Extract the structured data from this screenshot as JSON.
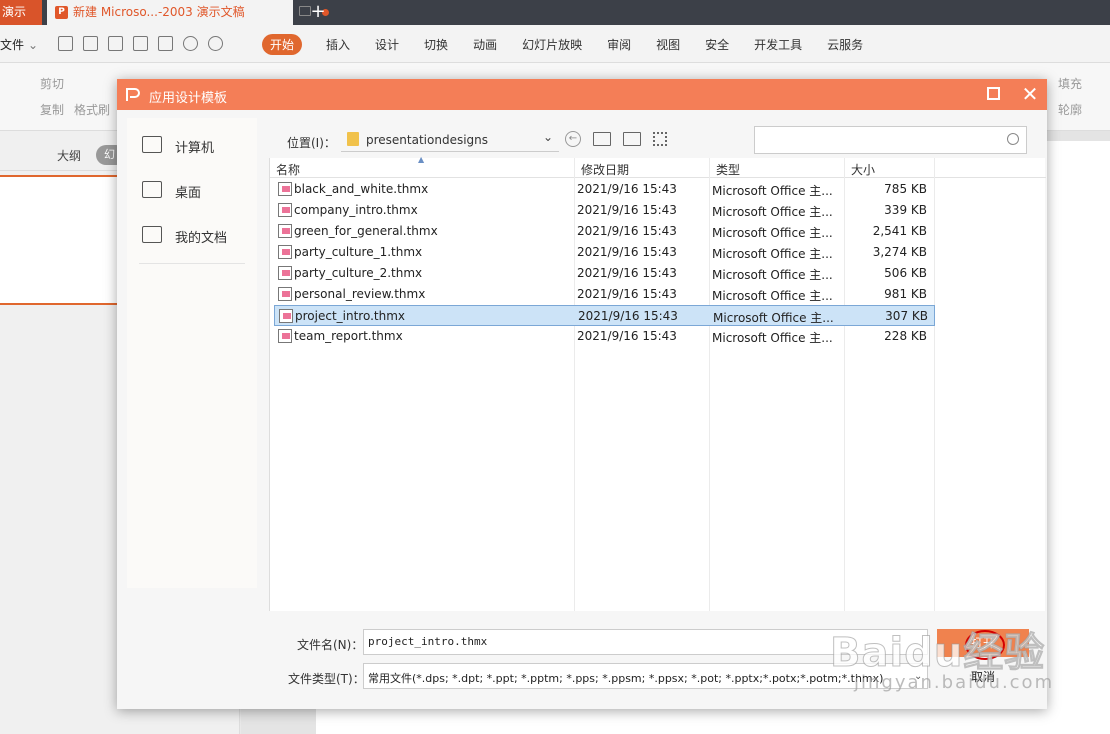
{
  "app": {
    "prev_tab": "演示",
    "doc_tab": "新建 Microso...-2003 演示文稿",
    "ppt_badge": "P",
    "new_tab": "+"
  },
  "menubar": {
    "file": "文件",
    "items": [
      "开始",
      "插入",
      "设计",
      "切换",
      "动画",
      "幻灯片放映",
      "审阅",
      "视图",
      "安全",
      "开发工具",
      "云服务"
    ],
    "active": "开始"
  },
  "ribbon": {
    "cut": "剪切",
    "copy": "复制",
    "format_painter": "格式刷",
    "fill": "填充",
    "outline": "轮廓"
  },
  "left_panel": {
    "outline_tab": "大纲",
    "slides_tab": "幻"
  },
  "dialog": {
    "title": "应用设计模板",
    "places": [
      {
        "label": "计算机",
        "icon": "computer-icon"
      },
      {
        "label": "桌面",
        "icon": "desktop-icon"
      },
      {
        "label": "我的文档",
        "icon": "documents-icon"
      }
    ],
    "location_label": "位置(I)：",
    "location_value": "presentationdesigns",
    "search_placeholder": "",
    "columns": [
      "名称",
      "修改日期",
      "类型",
      "大小"
    ],
    "files": [
      {
        "name": "black_and_white.thmx",
        "date": "2021/9/16 15:43",
        "type": "Microsoft Office 主...",
        "size": "785 KB"
      },
      {
        "name": "company_intro.thmx",
        "date": "2021/9/16 15:43",
        "type": "Microsoft Office 主...",
        "size": "339 KB"
      },
      {
        "name": "green_for_general.thmx",
        "date": "2021/9/16 15:43",
        "type": "Microsoft Office 主...",
        "size": "2,541 KB"
      },
      {
        "name": "party_culture_1.thmx",
        "date": "2021/9/16 15:43",
        "type": "Microsoft Office 主...",
        "size": "3,274 KB"
      },
      {
        "name": "party_culture_2.thmx",
        "date": "2021/9/16 15:43",
        "type": "Microsoft Office 主...",
        "size": "506 KB"
      },
      {
        "name": "personal_review.thmx",
        "date": "2021/9/16 15:43",
        "type": "Microsoft Office 主...",
        "size": "981 KB"
      },
      {
        "name": "project_intro.thmx",
        "date": "2021/9/16 15:43",
        "type": "Microsoft Office 主...",
        "size": "307 KB"
      },
      {
        "name": "team_report.thmx",
        "date": "2021/9/16 15:43",
        "type": "Microsoft Office 主...",
        "size": "228 KB"
      }
    ],
    "selected_index": 6,
    "filename_label": "文件名(N)：",
    "filename_value": "project_intro.thmx",
    "filetype_label": "文件类型(T)：",
    "filetype_value": "常用文件(*.dps; *.dpt; *.ppt; *.pptm; *.pps; *.ppsm; *.ppsx; *.pot; *.pptx;*.potx;*.potm;*.thmx)",
    "open_button": "打开",
    "cancel_button": "取消"
  },
  "watermark": {
    "main": "Baidu经验",
    "sub": "jingyan.baidu.com"
  },
  "colors": {
    "accent": "#e0672e",
    "dialog_title": "#f47e57",
    "selected_row": "#cce3f7"
  }
}
